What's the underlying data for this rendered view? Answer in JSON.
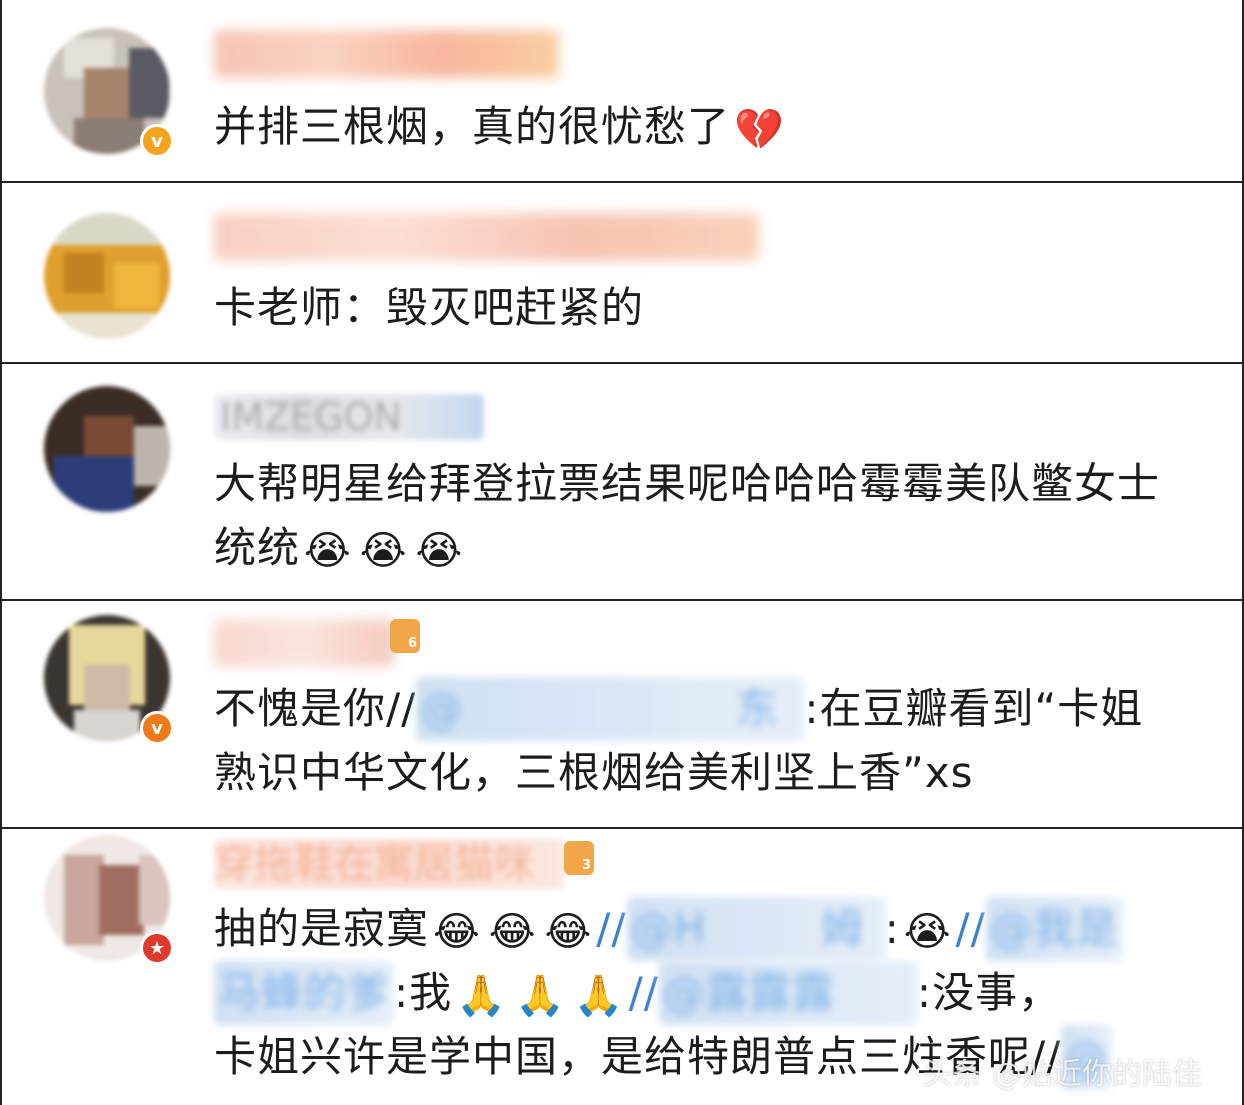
{
  "comments": [
    {
      "text_parts": [
        "并排三根烟，真的很忧愁了",
        "💔"
      ],
      "badge_icon": "verified-gold-v-icon",
      "badge_glyph": "v"
    },
    {
      "text_parts": [
        "卡老师：毁灭吧赶紧的"
      ]
    },
    {
      "username": "IMZEGON",
      "line1": "大帮明星给拜登拉票结果呢哈哈哈霉霉美队鳖女士",
      "line2": "统统",
      "emojis": [
        "😭",
        "😭",
        "😭"
      ]
    },
    {
      "line1_a": "不愧是你//",
      "line1_mention": "@",
      "line1_b": "东",
      "line1_c": ":在豆瓣看到“卡姐",
      "line2": "熟识中华文化，三根烟给美利坚上香”xs",
      "level": "6",
      "badge_glyph": "v"
    },
    {
      "username": "穿拖鞋在寓居猫咪",
      "level": "3",
      "line1_a": "抽的是寂寞",
      "line1_emojis": [
        "😂",
        "😂",
        "😂"
      ],
      "line1_b": "//",
      "line1_mention1": "@H",
      "line1_mention1_end": "姆",
      "line1_c": ":",
      "line1_emoji2": "😭",
      "line1_d": "//",
      "line1_mention2": "@我是",
      "line2_mention": "马蜂的爹",
      "line2_a": ":我",
      "line2_emojis": [
        "🙏",
        "🙏",
        "🙏"
      ],
      "line2_b": "//",
      "line2_mention2": "@露露露",
      "line2_c": ":没事，",
      "line3": "卡姐兴许是学中国，是给特朗普点三炷香呢//",
      "line3_mention": "@",
      "watermark": "头条 @贴近你的陆佳",
      "badge_glyph": "★"
    }
  ],
  "colors": {
    "gold_badge": "#f4a41e",
    "red_badge": "#e0382b",
    "mention": "#3f7fd0",
    "border": "#222222"
  }
}
